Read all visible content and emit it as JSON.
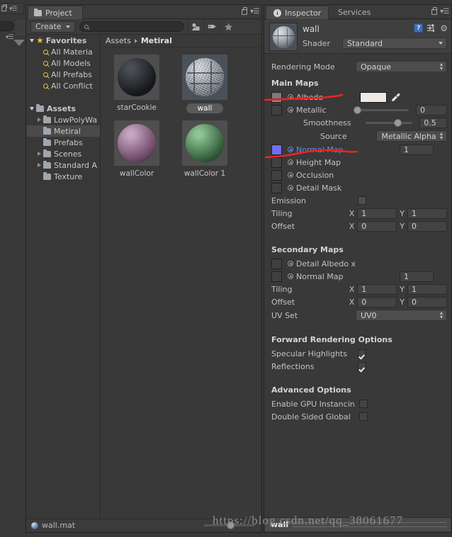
{
  "project_panel": {
    "tab_label": "Project",
    "create_label": "Create",
    "search_placeholder": "",
    "breadcrumb": {
      "root": "Assets",
      "current": "Metiral"
    },
    "toolbar_icons": [
      "asset-filter-icon",
      "label-filter-icon",
      "favorite-filter-icon"
    ],
    "tree": [
      {
        "label": "Favorites",
        "icon": "star-icon",
        "depth": 0,
        "expander": "down",
        "bold": true,
        "selected": false
      },
      {
        "label": "All Materia",
        "icon": "search-icon",
        "depth": 1,
        "expander": "none",
        "bold": false,
        "selected": false
      },
      {
        "label": "All Models",
        "icon": "search-icon",
        "depth": 1,
        "expander": "none",
        "bold": false,
        "selected": false
      },
      {
        "label": "All Prefabs",
        "icon": "search-icon",
        "depth": 1,
        "expander": "none",
        "bold": false,
        "selected": false
      },
      {
        "label": "All Conflict",
        "icon": "search-icon",
        "depth": 1,
        "expander": "none",
        "bold": false,
        "selected": false
      },
      {
        "label": "",
        "icon": "none",
        "depth": 0,
        "expander": "none",
        "bold": false,
        "selected": false
      },
      {
        "label": "Assets",
        "icon": "folder-icon",
        "depth": 0,
        "expander": "down",
        "bold": true,
        "selected": false
      },
      {
        "label": "LowPolyWa",
        "icon": "folder-icon",
        "depth": 1,
        "expander": "right",
        "bold": false,
        "selected": false
      },
      {
        "label": "Metiral",
        "icon": "folder-icon",
        "depth": 1,
        "expander": "none",
        "bold": false,
        "selected": true
      },
      {
        "label": "Prefabs",
        "icon": "folder-icon",
        "depth": 1,
        "expander": "none",
        "bold": false,
        "selected": false
      },
      {
        "label": "Scenes",
        "icon": "folder-icon",
        "depth": 1,
        "expander": "right",
        "bold": false,
        "selected": false
      },
      {
        "label": "Standard A",
        "icon": "folder-icon",
        "depth": 1,
        "expander": "right",
        "bold": false,
        "selected": false
      },
      {
        "label": "Texture",
        "icon": "folder-icon",
        "depth": 1,
        "expander": "none",
        "bold": false,
        "selected": false
      }
    ],
    "assets": [
      {
        "label": "starCookie",
        "selected": false,
        "kind": "sphere",
        "color_a": "#4a4e55",
        "color_b": "#15171a",
        "bg": "#4e4e4e"
      },
      {
        "label": "wall",
        "selected": true,
        "kind": "textured-sphere",
        "color_a": "#cfd3d8",
        "color_b": "#6d737c",
        "bg": "#4b5159"
      },
      {
        "label": "wallColor",
        "selected": false,
        "kind": "sphere",
        "color_a": "#c4a6c2",
        "color_b": "#6d4664",
        "bg": "#4e4e4e"
      },
      {
        "label": "wallColor 1",
        "selected": false,
        "kind": "sphere",
        "color_a": "#8fc495",
        "color_b": "#2f5c38",
        "bg": "#4e4e4e"
      }
    ],
    "status_file": "wall.mat"
  },
  "inspector": {
    "tab_label": "Inspector",
    "tab_services": "Services",
    "material_name": "wall",
    "shader_label": "Shader",
    "shader_value": "Standard",
    "rendering_mode_label": "Rendering Mode",
    "rendering_mode_value": "Opaque",
    "main_maps_title": "Main Maps",
    "albedo_label": "Albedo",
    "albedo_color": "#efe9e6",
    "metallic_label": "Metallic",
    "metallic_value": "0",
    "smoothness_label": "Smoothness",
    "smoothness_value": "0.5",
    "source_label": "Source",
    "source_value": "Metallic Alpha",
    "normal_map_label": "Normal Map",
    "normal_map_value": "1",
    "normal_map_swatch": "#6f6ff0",
    "height_map_label": "Height Map",
    "occlusion_label": "Occlusion",
    "detail_mask_label": "Detail Mask",
    "emission_label": "Emission",
    "tiling_label": "Tiling",
    "tiling_x": "1",
    "tiling_y": "1",
    "offset_label": "Offset",
    "offset_x": "0",
    "offset_y": "0",
    "secondary_maps_title": "Secondary Maps",
    "detail_albedo_label": "Detail Albedo x",
    "sec_normal_map_label": "Normal Map",
    "sec_normal_map_value": "1",
    "sec_tiling_label": "Tiling",
    "sec_tiling_x": "1",
    "sec_tiling_y": "1",
    "sec_offset_label": "Offset",
    "sec_offset_x": "0",
    "sec_offset_y": "0",
    "uv_set_label": "UV Set",
    "uv_set_value": "UV0",
    "forward_title": "Forward Rendering Options",
    "specular_label": "Specular Highlights",
    "specular_checked": true,
    "reflections_label": "Reflections",
    "reflections_checked": true,
    "advanced_title": "Advanced Options",
    "gpu_instancing_label": "Enable GPU Instancin",
    "gpu_instancing_checked": false,
    "double_sided_label": "Double Sided Global",
    "double_sided_checked": false,
    "axis_x": "X",
    "axis_y": "Y",
    "preview_name": "wall",
    "tool_icons": [
      "help-book-icon",
      "preset-icon",
      "gear-icon"
    ]
  },
  "annotation": {
    "color": "#ee2222"
  },
  "watermark": "https://blog.csdn.net/qq_38061677"
}
